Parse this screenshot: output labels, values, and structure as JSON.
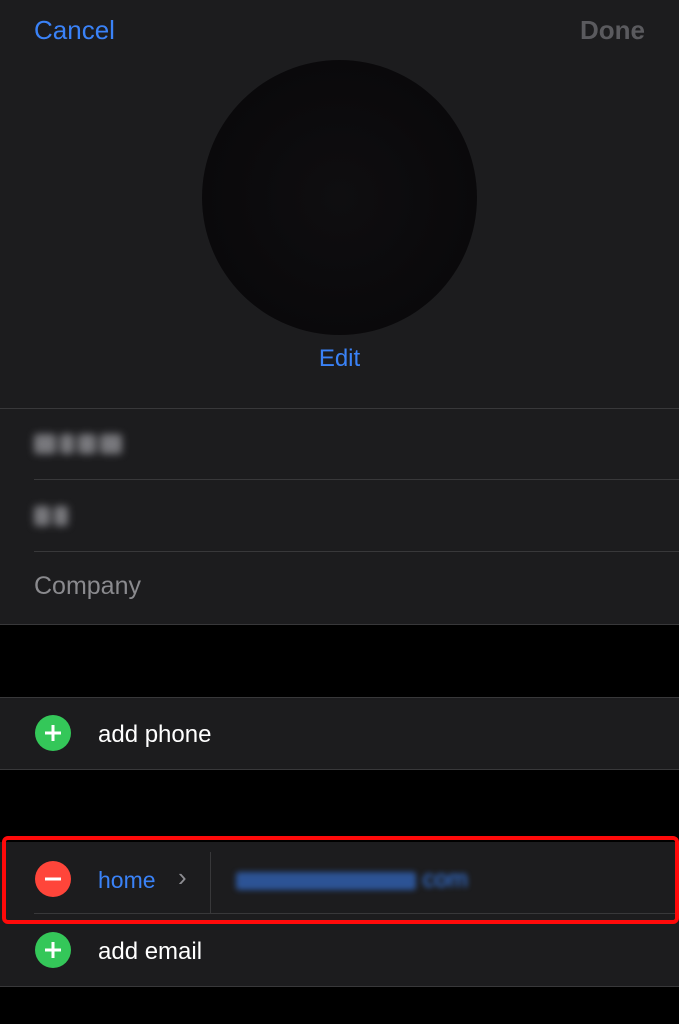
{
  "nav": {
    "cancel_label": "Cancel",
    "done_label": "Done"
  },
  "photo": {
    "edit_label": "Edit"
  },
  "name_fields": {
    "first_name_value": "",
    "last_name_value": "",
    "company_placeholder": "Company"
  },
  "phone": {
    "add_label": "add phone"
  },
  "email": {
    "entries": [
      {
        "label": "home",
        "value": "com"
      }
    ],
    "add_label": "add email"
  },
  "colors": {
    "accent": "#3a82f7",
    "add": "#34c759",
    "remove": "#ff453a",
    "highlight": "#ff0a0a"
  },
  "icons": [
    "plus-circle-icon",
    "minus-circle-icon",
    "chevron-right-icon"
  ]
}
